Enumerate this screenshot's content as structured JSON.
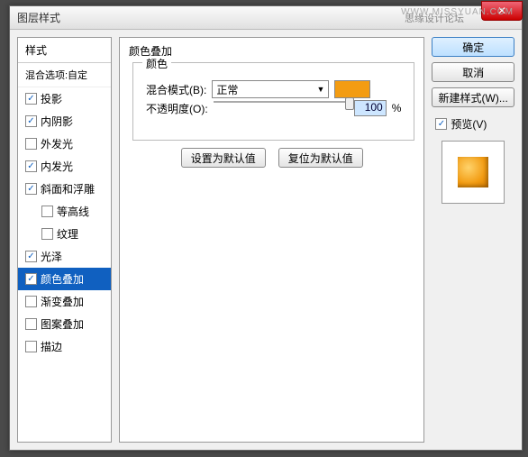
{
  "window": {
    "title": "图层样式",
    "watermark_left": "思缘设计论坛",
    "watermark": "WWW.MISSYUAN.COM"
  },
  "left": {
    "header": "样式",
    "sub": "混合选项:自定",
    "items": [
      {
        "label": "投影",
        "checked": true,
        "indent": false
      },
      {
        "label": "内阴影",
        "checked": true,
        "indent": false
      },
      {
        "label": "外发光",
        "checked": false,
        "indent": false
      },
      {
        "label": "内发光",
        "checked": true,
        "indent": false
      },
      {
        "label": "斜面和浮雕",
        "checked": true,
        "indent": false
      },
      {
        "label": "等高线",
        "checked": false,
        "indent": true
      },
      {
        "label": "纹理",
        "checked": false,
        "indent": true
      },
      {
        "label": "光泽",
        "checked": true,
        "indent": false
      },
      {
        "label": "颜色叠加",
        "checked": true,
        "indent": false,
        "selected": true
      },
      {
        "label": "渐变叠加",
        "checked": false,
        "indent": false
      },
      {
        "label": "图案叠加",
        "checked": false,
        "indent": false
      },
      {
        "label": "描边",
        "checked": false,
        "indent": false
      }
    ]
  },
  "center": {
    "title": "颜色叠加",
    "fieldset_title": "颜色",
    "blend_label": "混合模式(B):",
    "blend_value": "正常",
    "swatch_color": "#f39c12",
    "opacity_label": "不透明度(O):",
    "opacity_value": "100",
    "pct": "%",
    "btn_default": "设置为默认值",
    "btn_reset": "复位为默认值"
  },
  "right": {
    "ok": "确定",
    "cancel": "取消",
    "new_style": "新建样式(W)...",
    "preview_label": "预览(V)",
    "preview_checked": true
  }
}
